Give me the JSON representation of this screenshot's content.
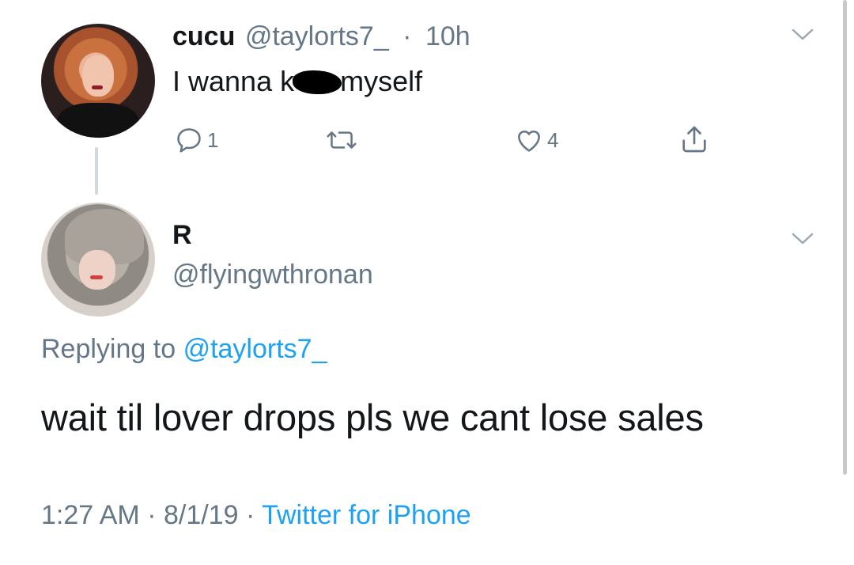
{
  "parent_tweet": {
    "name": "cucu",
    "handle": "@taylorts7_",
    "time": "10h",
    "text_before": "I wanna k",
    "text_after": "myself",
    "reply_count": "1",
    "like_count": "4"
  },
  "reply_tweet": {
    "name": "R",
    "handle": "@flyingwthronan",
    "replying_to_label": "Replying to",
    "replying_to_handle": "@taylorts7_",
    "text": "wait til lover drops pls we cant lose sales",
    "time": "1:27 AM",
    "date": "8/1/19",
    "source": "Twitter for iPhone"
  },
  "icons": {
    "reply": "reply-icon",
    "retweet": "retweet-icon",
    "like": "heart-icon",
    "share": "share-icon",
    "more": "chevron-down-icon"
  },
  "colors": {
    "text": "#14171a",
    "secondary": "#657786",
    "link": "#1da1f2",
    "thread_line": "#cfd9de"
  }
}
